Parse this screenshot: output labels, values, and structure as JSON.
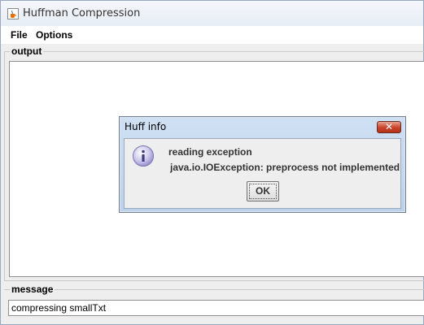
{
  "window": {
    "title": "Huffman Compression",
    "icon": "java-coffee-icon"
  },
  "menu": {
    "items": [
      "File",
      "Options"
    ]
  },
  "output": {
    "label": "output",
    "text": ""
  },
  "message": {
    "label": "message",
    "value": "compressing smallTxt"
  },
  "dialog": {
    "title": "Huff info",
    "icon": "info-icon",
    "line1": "reading exception",
    "line2": "java.io.IOException: preprocess not implemented",
    "ok_label": "OK",
    "close_glyph": "✕"
  },
  "colors": {
    "dialog_frame": "#bcd2ea",
    "close_button": "#c7432a",
    "info_icon": "#8d86c9"
  }
}
